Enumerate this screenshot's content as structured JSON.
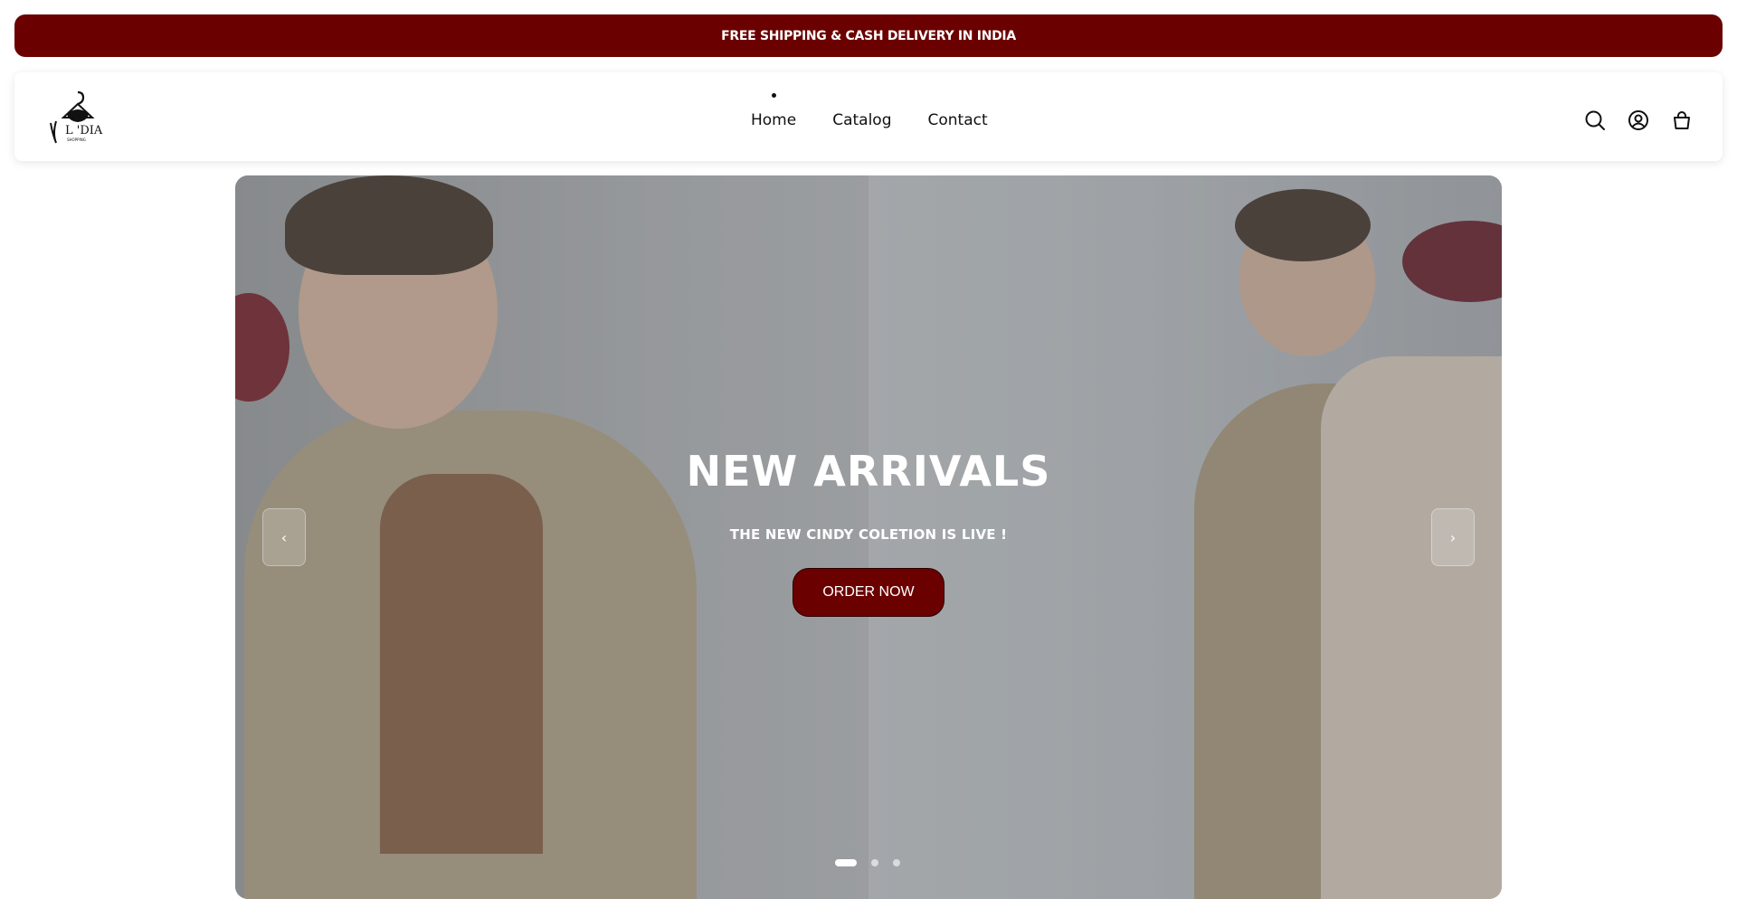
{
  "announcement": {
    "text": "FREE SHIPPING & CASH DELIVERY IN INDIA"
  },
  "brand": {
    "logo_text": "L 'DIA",
    "logo_subtext": "SHOPPING",
    "accent_color": "#6b0000"
  },
  "nav": {
    "items": [
      {
        "label": "Home",
        "active": true
      },
      {
        "label": "Catalog",
        "active": false
      },
      {
        "label": "Contact",
        "active": false
      }
    ]
  },
  "header_icons": [
    "search-icon",
    "account-icon",
    "cart-icon"
  ],
  "hero": {
    "title": "NEW ARRIVALS",
    "subtitle": "THE NEW CINDY COLETION IS LIVE !",
    "cta_label": "ORDER NOW",
    "prev_arrow": "‹",
    "next_arrow": "›",
    "slide_count": 3,
    "active_slide": 1
  }
}
